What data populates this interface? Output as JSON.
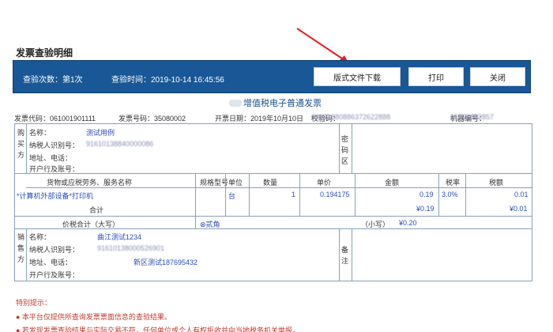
{
  "page": {
    "title": "发票查验明细"
  },
  "header_bar": {
    "check_count": "查验次数：第1次",
    "check_time": "查验时间：2019-10-14 16:45:56",
    "buttons": {
      "download": "版式文件下载",
      "print": "打印",
      "close": "关闭"
    }
  },
  "invoice": {
    "title": "增值税电子普通发票",
    "meta": {
      "code": "发票代码：061001901111",
      "number": "发票号码：35080002",
      "date": "开票日期：2019年10月10日",
      "check_code_label": "校验码：",
      "check_code_value": "08881880886372622888",
      "machine_label": "机器编号：",
      "machine_value": "66798882857"
    },
    "buyer": {
      "section": "购买方",
      "name_label": "名称：",
      "name_value": "测试用例",
      "tax_label": "纳税人识别号：",
      "tax_value": "91610138840000086",
      "addr_label": "地址、电话：",
      "bank_label": "开户行及账号：",
      "password_label": "密码区"
    },
    "items": {
      "headers": {
        "name": "货物或应税劳务、服务名称",
        "spec": "规格型号",
        "unit": "单位",
        "qty": "数量",
        "price": "单价",
        "amount": "金额",
        "rate": "税率",
        "tax": "税额"
      },
      "rows": [
        {
          "name": "*计算机外部设备*打印机",
          "unit": "台",
          "qty": "1",
          "price": "0.194175",
          "amount": "0.19",
          "rate": "3.0%",
          "tax": "0.01"
        }
      ],
      "total_label": "合计",
      "total_amount": "¥0.19",
      "total_tax": "¥0.01"
    },
    "sum": {
      "label": "价税合计（大写）",
      "upper": "⊗贰角",
      "lower_label": "（小写）",
      "lower_value": "¥0.20"
    },
    "seller": {
      "section": "销售方",
      "name_label": "名称：",
      "name_value": "曲江测试1234",
      "tax_label": "纳税人识别号：",
      "tax_value": "91610138000526901",
      "addr_label": "地址、电话：",
      "addr_value": "新区测试187695432",
      "bank_label": "开户行及账号：",
      "remark_label": "备注"
    }
  },
  "notice": {
    "title": "特别提示：",
    "lines": [
      "● 本平台仅提供所查询发票票面信息的查验结果。",
      "● 若发现发票查验结果与实际交易不符，任何单位或个人有权拒收并向当地税务机关举报。"
    ]
  },
  "colors": {
    "bar": "#1a5796",
    "accent_red": "#c0392b",
    "link_blue": "#2a4cc2"
  }
}
